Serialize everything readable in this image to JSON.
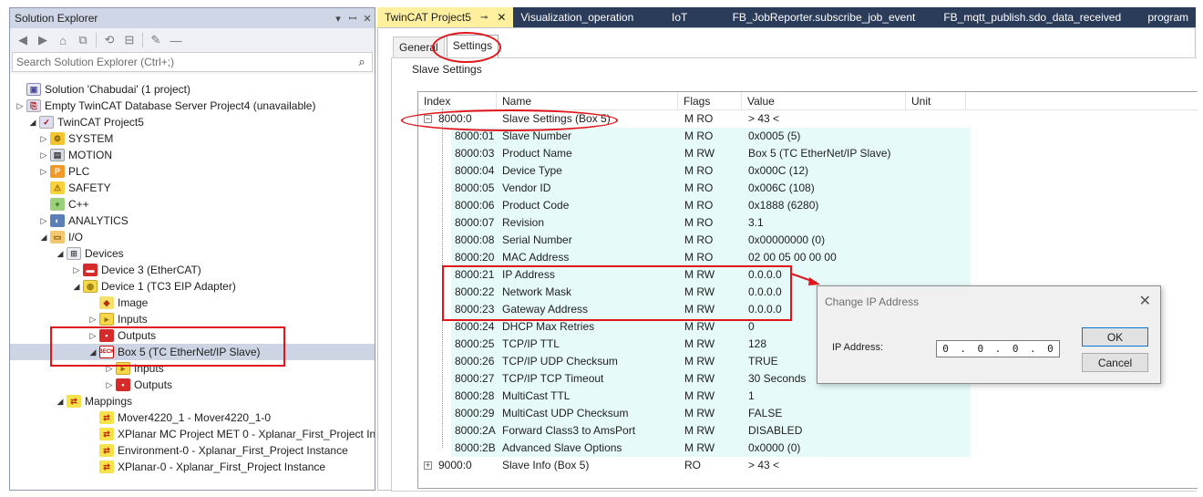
{
  "solution_explorer": {
    "title": "Solution Explorer",
    "pin": "▾ ꟷ ✕",
    "search_placeholder": "Search Solution Explorer (Ctrl+;)",
    "items": [
      {
        "label": "Solution 'Chabudai' (1 project)",
        "icon": "solution-icon"
      },
      {
        "label": "Empty TwinCAT Database Server Project4 (unavailable)",
        "icon": "project-icon"
      },
      {
        "label": "TwinCAT Project5",
        "icon": "twincat-project-icon"
      },
      {
        "label": "SYSTEM",
        "icon": "system-icon"
      },
      {
        "label": "MOTION",
        "icon": "motion-icon"
      },
      {
        "label": "PLC",
        "icon": "plc-icon"
      },
      {
        "label": "SAFETY",
        "icon": "safety-icon"
      },
      {
        "label": "C++",
        "icon": "cpp-icon"
      },
      {
        "label": "ANALYTICS",
        "icon": "analytics-icon"
      },
      {
        "label": "I/O",
        "icon": "io-icon"
      },
      {
        "label": "Devices",
        "icon": "devices-icon"
      },
      {
        "label": "Device 3 (EtherCAT)",
        "icon": "ethercat-device-icon"
      },
      {
        "label": "Device 1 (TC3 EIP Adapter)",
        "icon": "eip-device-icon"
      },
      {
        "label": "Image",
        "icon": "image-icon"
      },
      {
        "label": "Inputs",
        "icon": "inputs-icon"
      },
      {
        "label": "Outputs",
        "icon": "outputs-icon"
      },
      {
        "label": "Box 5 (TC EtherNet/IP Slave)",
        "icon": "beckhoff-box-icon"
      },
      {
        "label": "Inputs",
        "icon": "inputs-icon"
      },
      {
        "label": "Outputs",
        "icon": "outputs-icon"
      },
      {
        "label": "Mappings",
        "icon": "mappings-icon"
      },
      {
        "label": "Mover4220_1 - Mover4220_1-0",
        "icon": "mapping-icon"
      },
      {
        "label": "XPlanar MC Project MET 0 - Xplanar_First_Project Instance",
        "icon": "mapping-icon"
      },
      {
        "label": "Environment-0 - Xplanar_First_Project Instance",
        "icon": "mapping-icon"
      },
      {
        "label": "XPlanar-0 - Xplanar_First_Project Instance",
        "icon": "mapping-icon"
      }
    ]
  },
  "tabs": [
    {
      "label": "TwinCAT Project5"
    },
    {
      "label": "Visualization_operation"
    },
    {
      "label": "IoT"
    },
    {
      "label": "FB_JobReporter.subscribe_job_event"
    },
    {
      "label": "FB_mqtt_publish.sdo_data_received"
    },
    {
      "label": "program"
    }
  ],
  "subtabs": [
    {
      "label": "General"
    },
    {
      "label": "Settings"
    }
  ],
  "group_label": "Slave Settings",
  "columns": [
    "Index",
    "Name",
    "Flags",
    "Value",
    "Unit"
  ],
  "rows": [
    {
      "index": "8000:0",
      "name": "Slave Settings (Box 5)",
      "flags": "M RO",
      "value": "> 43 <",
      "expander": "−"
    },
    {
      "index": "8000:01",
      "name": "Slave Number",
      "flags": "M RO",
      "value": "0x0005 (5)"
    },
    {
      "index": "8000:03",
      "name": "Product Name",
      "flags": "M RW",
      "value": "Box 5 (TC EtherNet/IP Slave)"
    },
    {
      "index": "8000:04",
      "name": "Device Type",
      "flags": "M RO",
      "value": "0x000C (12)"
    },
    {
      "index": "8000:05",
      "name": "Vendor ID",
      "flags": "M RO",
      "value": "0x006C (108)"
    },
    {
      "index": "8000:06",
      "name": "Product Code",
      "flags": "M RO",
      "value": "0x1888 (6280)"
    },
    {
      "index": "8000:07",
      "name": "Revision",
      "flags": "M RO",
      "value": "3.1"
    },
    {
      "index": "8000:08",
      "name": "Serial Number",
      "flags": "M RO",
      "value": "0x00000000 (0)"
    },
    {
      "index": "8000:20",
      "name": "MAC Address",
      "flags": "M RO",
      "value": "02 00 05 00 00 00"
    },
    {
      "index": "8000:21",
      "name": "IP Address",
      "flags": "M RW",
      "value": "0.0.0.0"
    },
    {
      "index": "8000:22",
      "name": "Network Mask",
      "flags": "M RW",
      "value": "0.0.0.0"
    },
    {
      "index": "8000:23",
      "name": "Gateway Address",
      "flags": "M RW",
      "value": "0.0.0.0"
    },
    {
      "index": "8000:24",
      "name": "DHCP Max Retries",
      "flags": "M RW",
      "value": "0"
    },
    {
      "index": "8000:25",
      "name": "TCP/IP TTL",
      "flags": "M RW",
      "value": "128"
    },
    {
      "index": "8000:26",
      "name": "TCP/IP UDP Checksum",
      "flags": "M RW",
      "value": "TRUE"
    },
    {
      "index": "8000:27",
      "name": "TCP/IP TCP Timeout",
      "flags": "M RW",
      "value": "30 Seconds"
    },
    {
      "index": "8000:28",
      "name": "MultiCast TTL",
      "flags": "M RW",
      "value": "1"
    },
    {
      "index": "8000:29",
      "name": "MultiCast UDP Checksum",
      "flags": "M RW",
      "value": "FALSE"
    },
    {
      "index": "8000:2A",
      "name": "Forward Class3 to AmsPort",
      "flags": "M RW",
      "value": "DISABLED"
    },
    {
      "index": "8000:2B",
      "name": "Advanced Slave Options",
      "flags": "M RW",
      "value": "0x0000 (0)"
    },
    {
      "index": "9000:0",
      "name": "Slave Info (Box 5)",
      "flags": "RO",
      "value": "> 43 <",
      "expander": "+"
    }
  ],
  "dialog": {
    "title": "Change IP Address",
    "ip_label": "IP Address:",
    "ip_octets": [
      "0",
      "0",
      "0",
      "0"
    ],
    "ok_label": "OK",
    "cancel_label": "Cancel"
  },
  "annotation_color": "#e0141b",
  "accent_tab_color": "#fff0a0"
}
